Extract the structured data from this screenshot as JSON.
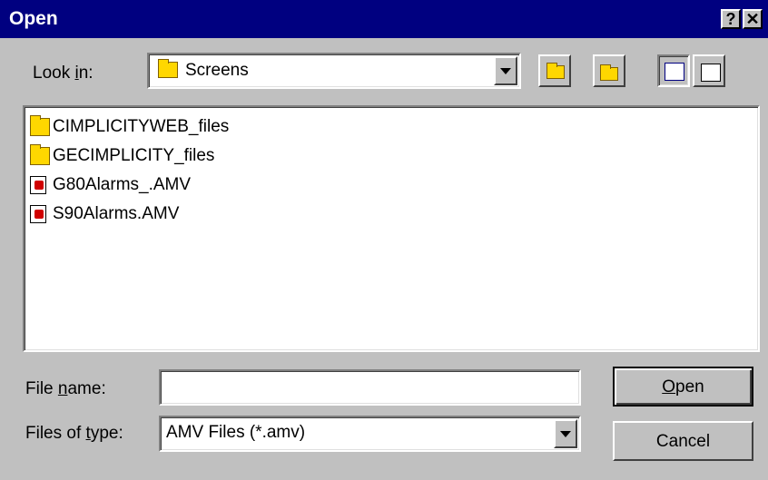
{
  "window": {
    "title": "Open",
    "help_label": "?",
    "close_label": "✕"
  },
  "lookin": {
    "label_prefix": "Look ",
    "label_accel": "i",
    "label_suffix": "n:",
    "value": "Screens"
  },
  "toolbar": {
    "icons": [
      "up-one-level-icon",
      "create-new-folder-icon",
      "list-view-icon",
      "details-view-icon"
    ]
  },
  "files": [
    {
      "name": "CIMPLICITYWEB_files",
      "type": "folder"
    },
    {
      "name": "GECIMPLICITY_files",
      "type": "folder"
    },
    {
      "name": "G80Alarms_.AMV",
      "type": "amv"
    },
    {
      "name": "S90Alarms.AMV",
      "type": "amv"
    }
  ],
  "filename": {
    "label_prefix": "File ",
    "label_accel": "n",
    "label_suffix": "ame:",
    "value": ""
  },
  "filetype": {
    "label_prefix": "Files of ",
    "label_accel": "t",
    "label_suffix": "ype:",
    "value": "AMV Files (*.amv)"
  },
  "buttons": {
    "open_accel": "O",
    "open_suffix": "pen",
    "cancel": "Cancel"
  },
  "colors": {
    "titlebar": "#000080",
    "face": "#c0c0c0"
  }
}
